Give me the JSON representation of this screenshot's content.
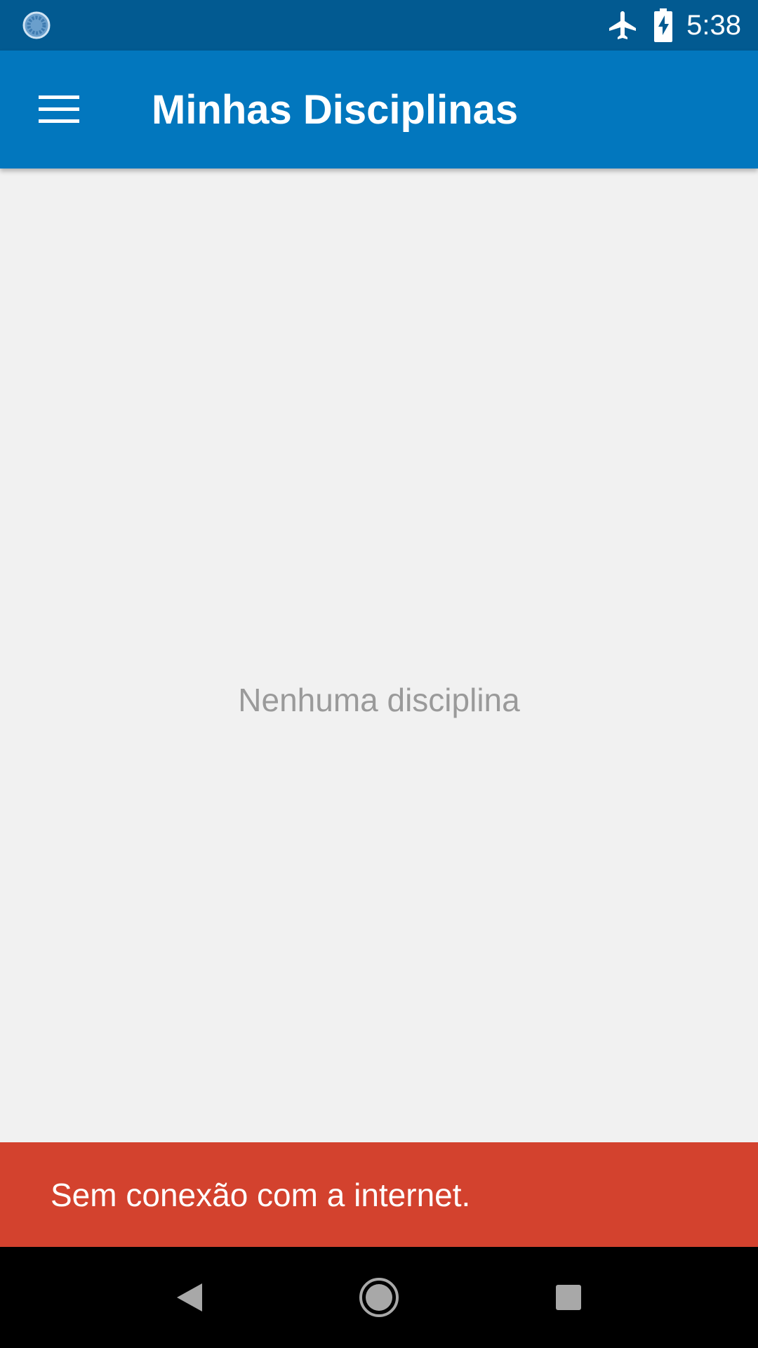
{
  "status_bar": {
    "time": "5:38",
    "icons": [
      "loading-circle-icon",
      "airplane-mode-icon",
      "battery-charging-icon"
    ]
  },
  "app_bar": {
    "title": "Minhas Disciplinas",
    "menu_icon": "menu-icon"
  },
  "main": {
    "empty_message": "Nenhuma disciplina"
  },
  "snackbar": {
    "message": "Sem conexão com a internet."
  },
  "nav_bar": {
    "icons": [
      "back-icon",
      "home-icon",
      "recents-icon"
    ]
  },
  "colors": {
    "status_bar": "#025a91",
    "app_bar": "#0277be",
    "background": "#f1f1f1",
    "snackbar": "#d3422e",
    "nav_bar": "#000000"
  }
}
